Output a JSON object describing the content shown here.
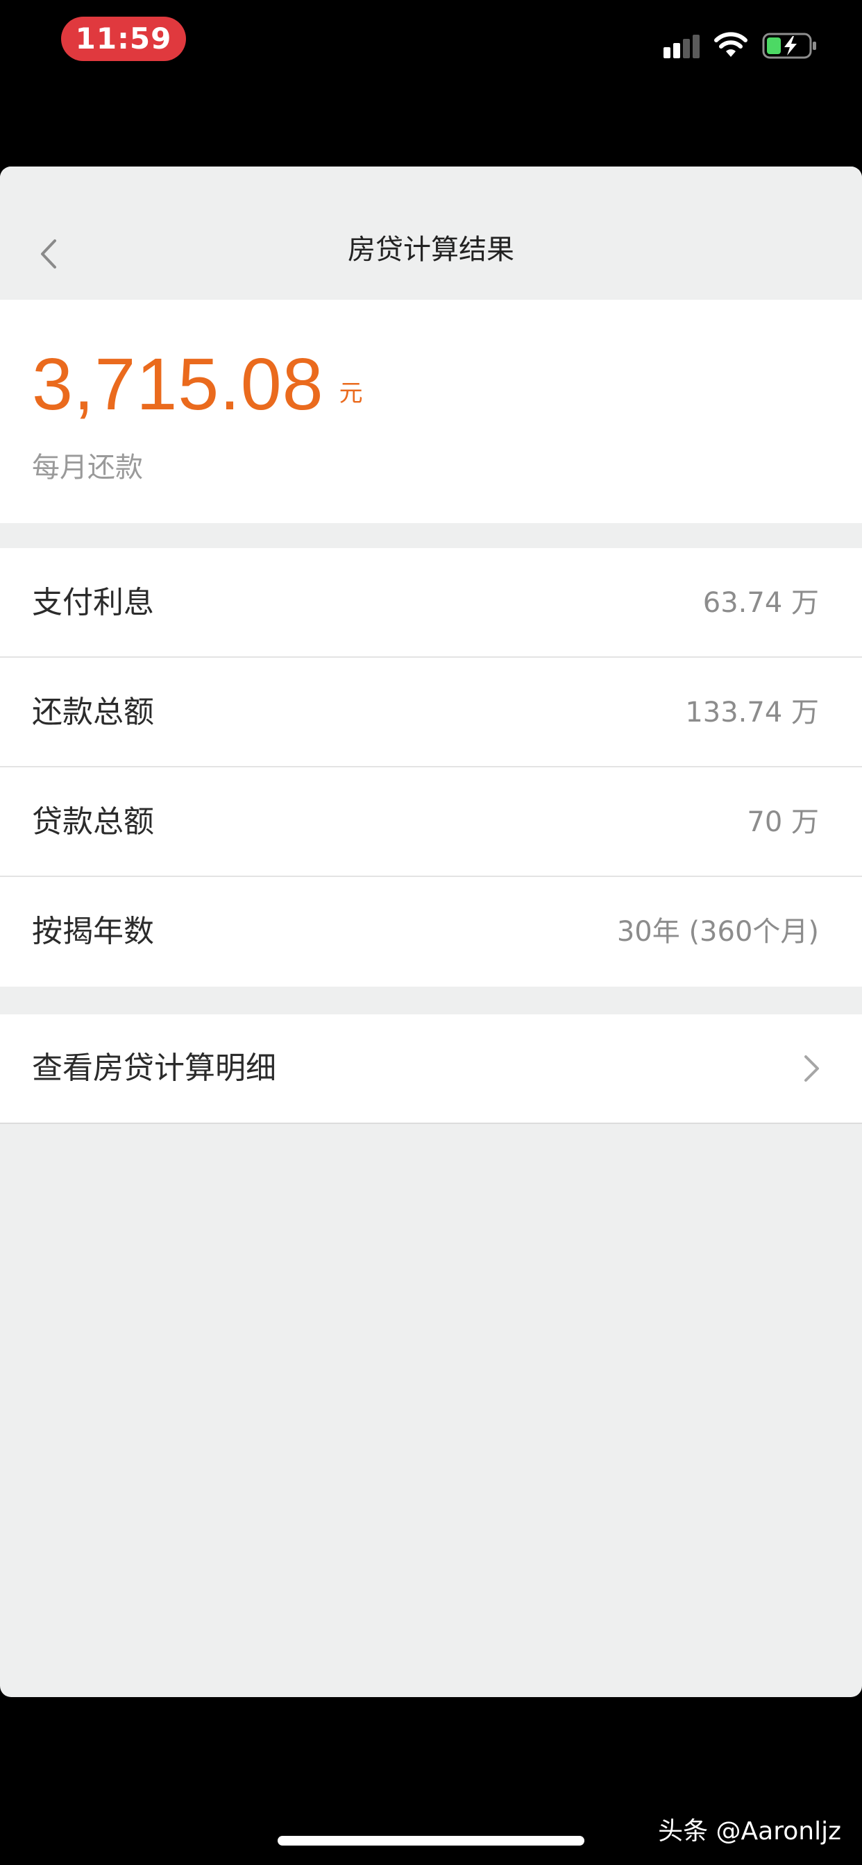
{
  "status_bar": {
    "time": "11:59"
  },
  "icons": {
    "signal": "signal-icon",
    "wifi": "wifi-icon",
    "battery": "battery-charging-icon",
    "back": "chevron-left-icon",
    "detail": "chevron-right-icon"
  },
  "nav": {
    "title": "房贷计算结果"
  },
  "summary": {
    "amount": "3,715.08",
    "unit": "元",
    "label": "每月还款"
  },
  "info": {
    "items": [
      {
        "label": "支付利息",
        "value": "63.74 万"
      },
      {
        "label": "还款总额",
        "value": "133.74 万"
      },
      {
        "label": "贷款总额",
        "value": "70 万"
      },
      {
        "label": "按揭年数",
        "value": "30年 (360个月)"
      }
    ]
  },
  "detail": {
    "label": "查看房贷计算明细"
  },
  "watermark": {
    "text": "头条 @Aaronljz"
  },
  "colors": {
    "accent": "#ea6a1d",
    "time_pill": "#e0393e",
    "background": "#eeefef",
    "battery_fill": "#4cd964"
  }
}
